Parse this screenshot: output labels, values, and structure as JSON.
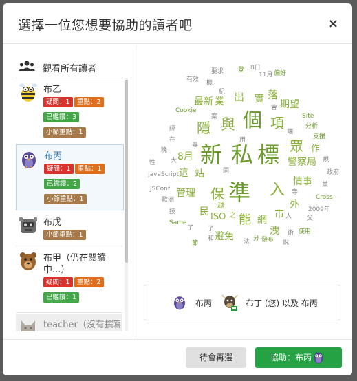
{
  "dialog": {
    "title": "選擇一位您想要協助的讀者吧",
    "close_label": "×"
  },
  "sidebar": {
    "view_all_label": "觀看所有讀者",
    "readers": [
      {
        "name": "布乙",
        "avatar": "bee-avatar-icon",
        "selected": false,
        "badges": [
          {
            "text": "疑問：1",
            "color": "red"
          },
          {
            "text": "重點：2",
            "color": "orange"
          },
          {
            "text": "已鑑讚：3",
            "color": "green"
          },
          {
            "text": "小節重點：1",
            "color": "brown"
          }
        ]
      },
      {
        "name": "布丙",
        "avatar": "bird-avatar-icon",
        "selected": true,
        "badges": [
          {
            "text": "疑問：1",
            "color": "red"
          },
          {
            "text": "重點：1",
            "color": "orange"
          },
          {
            "text": "已鑑讚：2",
            "color": "green"
          },
          {
            "text": "小節重點：1",
            "color": "brown"
          }
        ]
      },
      {
        "name": "布戊",
        "avatar": "robot-avatar-icon",
        "selected": false,
        "badges": [
          {
            "text": "小節重點：1",
            "color": "brown"
          }
        ]
      },
      {
        "name": "布甲（仍在閱讀中...）",
        "avatar": "bear-avatar-icon",
        "selected": false,
        "badges": [
          {
            "text": "疑問：1",
            "color": "red"
          },
          {
            "text": "重點：2",
            "color": "orange"
          },
          {
            "text": "已鑑讚：1",
            "color": "green"
          }
        ]
      },
      {
        "name": "teacher（沒有撰寫",
        "avatar": "cat-avatar-icon",
        "selected": false,
        "badges": []
      }
    ]
  },
  "word_cloud": {
    "words": [
      "準",
      "標",
      "私",
      "新",
      "個",
      "與",
      "眾",
      "入",
      "隱",
      "項",
      "保",
      "能",
      "期望",
      "最新",
      "業",
      "情事",
      "警察局",
      "出",
      "落",
      "實",
      "8月",
      "站",
      "這",
      "管理",
      "民",
      "網",
      "外",
      "市",
      "洩",
      "避免",
      "作",
      "ISO",
      "之",
      "越",
      "要求",
      "登",
      "8日",
      "11月",
      "偏好",
      "有效",
      "機",
      "Cookie",
      "紀",
      "會",
      "Site",
      "分析",
      "支援",
      "規",
      "政府",
      "黨",
      "Cross",
      "2009年",
      "父",
      "使用",
      "術",
      "發布",
      "分",
      "法",
      "和",
      "節",
      "Same",
      "了",
      "技",
      "歐洲",
      "JSConf",
      "JavaScript",
      "性",
      "大",
      "晚",
      "在",
      "經",
      "專",
      "用",
      "案",
      "端",
      "同",
      "人",
      "寺",
      "說",
      "了"
    ]
  },
  "selection": {
    "reader_name": "布丙",
    "helper_text": "布丁 (您) 以及 布丙"
  },
  "footer": {
    "later_label": "待會再選",
    "help_label": "協助：布丙"
  },
  "colors": {
    "accent_green": "#25a244",
    "selected_name": "#3b7ec4",
    "cloud_green": "#8ab03a"
  }
}
